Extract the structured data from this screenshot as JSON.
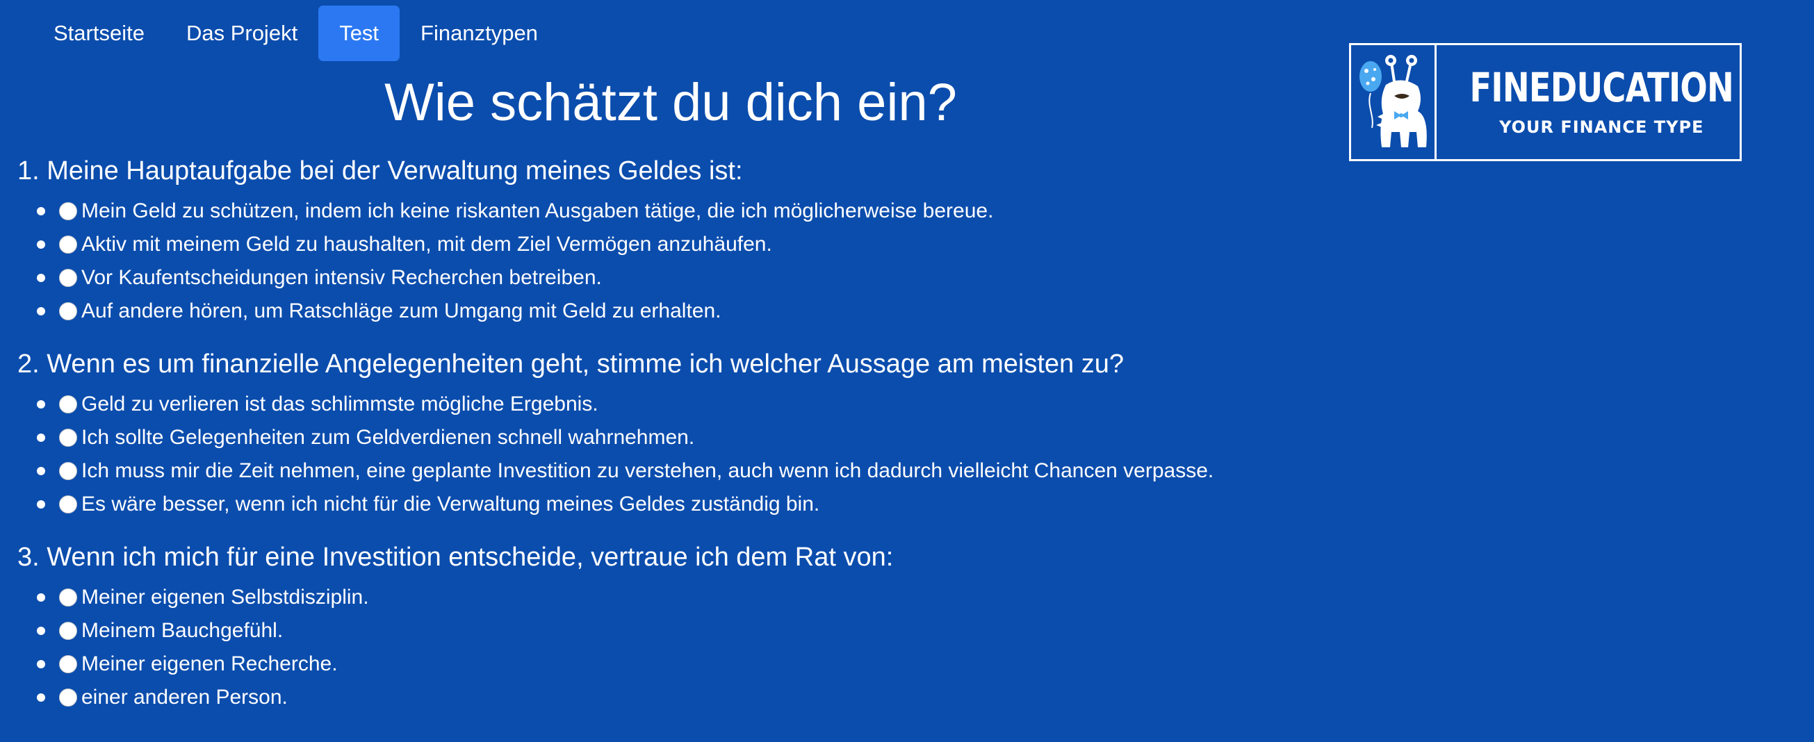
{
  "nav": {
    "items": [
      {
        "label": "Startseite",
        "active": false
      },
      {
        "label": "Das Projekt",
        "active": false
      },
      {
        "label": "Test",
        "active": true
      },
      {
        "label": "Finanztypen",
        "active": false
      }
    ]
  },
  "logo": {
    "title": "FINEDUCATION",
    "subtitle": "YOUR FINANCE TYPE"
  },
  "page_title": "Wie schätzt du dich ein?",
  "questions": [
    {
      "heading": "1. Meine Hauptaufgabe bei der Verwaltung meines Geldes ist:",
      "answers": [
        "Mein Geld zu schützen, indem ich keine riskanten Ausgaben tätige, die ich möglicherweise bereue.",
        "Aktiv mit meinem Geld zu haushalten, mit dem Ziel Vermögen anzuhäufen.",
        "Vor Kaufentscheidungen intensiv Recherchen betreiben.",
        "Auf andere hören, um Ratschläge zum Umgang mit Geld zu erhalten."
      ]
    },
    {
      "heading": "2. Wenn es um finanzielle Angelegenheiten geht, stimme ich welcher Aussage am meisten zu?",
      "answers": [
        "Geld zu verlieren ist das schlimmste mögliche Ergebnis.",
        "Ich sollte Gelegenheiten zum Geldverdienen schnell wahrnehmen.",
        "Ich muss mir die Zeit nehmen, eine geplante Investition zu verstehen, auch wenn ich dadurch vielleicht Chancen verpasse.",
        "Es wäre besser, wenn ich nicht für die Verwaltung meines Geldes zuständig bin."
      ]
    },
    {
      "heading": "3. Wenn ich mich für eine Investition entscheide, vertraue ich dem Rat von:",
      "answers": [
        "Meiner eigenen Selbstdisziplin.",
        "Meinem Bauchgefühl.",
        "Meiner eigenen Recherche.",
        "einer anderen Person."
      ]
    }
  ],
  "colors": {
    "background": "#0b4dad",
    "active_tab": "#2b78f2",
    "text": "#ffffff"
  }
}
